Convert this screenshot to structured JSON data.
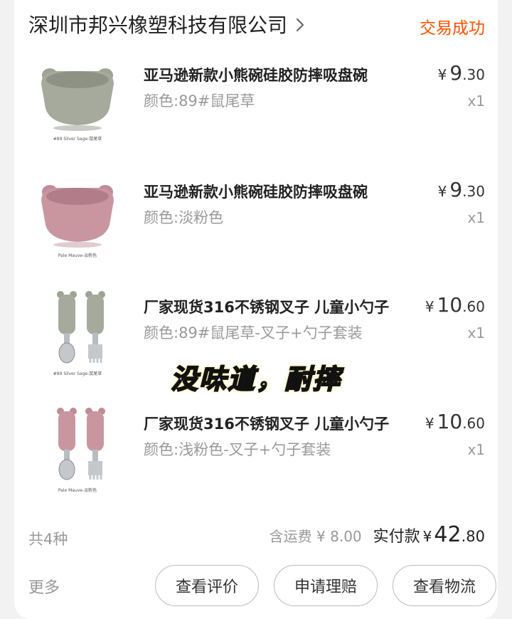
{
  "order": {
    "shop_name": "深圳市邦兴橡塑科技有限公司",
    "status": "交易成功",
    "status_color": "#ff5000"
  },
  "items": [
    {
      "title": "亚马逊新款小熊碗硅胶防摔吸盘碗",
      "spec": "颜色:89#鼠尾草",
      "currency": "¥",
      "price_int": "9",
      "price_dec": ".30",
      "qty": "x1",
      "image_caption": "#89 Silver Sage-鼠尾草",
      "image_color": "#9ea394"
    },
    {
      "title": "亚马逊新款小熊碗硅胶防摔吸盘碗",
      "spec": "颜色:淡粉色",
      "currency": "¥",
      "price_int": "9",
      "price_dec": ".30",
      "qty": "x1",
      "image_caption": "Pale Mauve-淡粉色",
      "image_color": "#c08c97"
    },
    {
      "title": "厂家现货316不锈钢叉子 儿童小勺子",
      "spec": "颜色:89#鼠尾草-叉子+勺子套装",
      "currency": "¥",
      "price_int": "10",
      "price_dec": ".60",
      "qty": "x1",
      "image_caption": "#89 Silver Sage-鼠尾草",
      "image_color": "#9ea394"
    },
    {
      "title": "厂家现货316不锈钢叉子 儿童小勺子",
      "spec": "颜色:浅粉色-叉子+勺子套装",
      "currency": "¥",
      "price_int": "10",
      "price_dec": ".60",
      "qty": "x1",
      "image_caption": "Pale Mauve-淡粉色",
      "image_color": "#c08c97"
    }
  ],
  "overlay_text": "没味道，耐摔",
  "summary": {
    "count": "共4种",
    "shipping": "含运费 ¥ 8.00",
    "paid_label": "实付款",
    "paid_currency": "¥",
    "paid_int": "42",
    "paid_dec": ".80"
  },
  "actions": {
    "more": "更多",
    "review": "查看评价",
    "claim": "申请理赔",
    "logistics": "查看物流"
  },
  "icons": {
    "chevron": "chevron-right-icon"
  }
}
